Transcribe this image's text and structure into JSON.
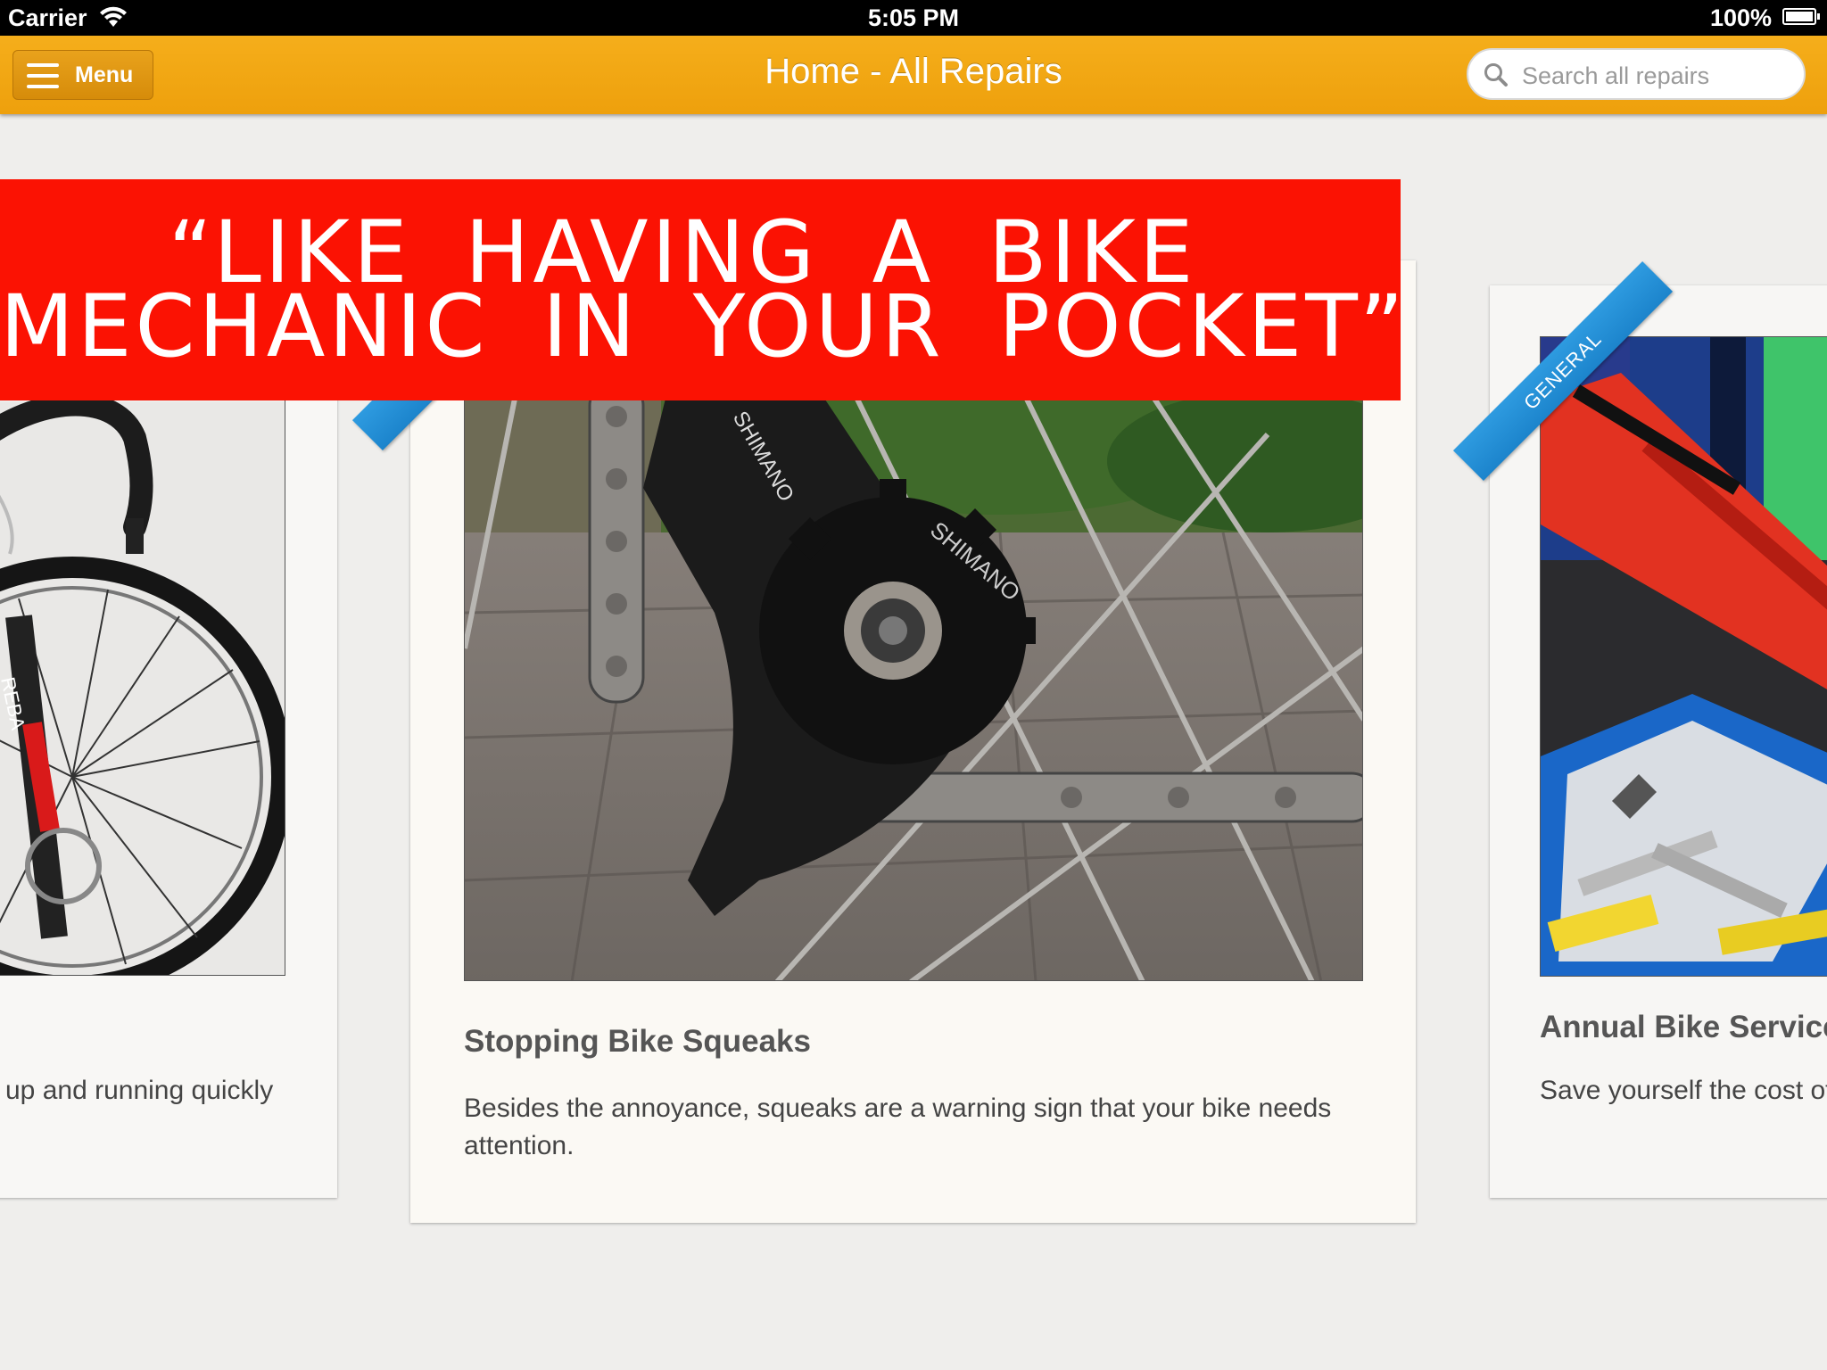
{
  "status_bar": {
    "carrier": "Carrier",
    "time": "5:05 PM",
    "battery": "100%"
  },
  "nav": {
    "menu_label": "Menu",
    "title": "Home - All Repairs",
    "search_placeholder": "Search all repairs"
  },
  "promo": {
    "line1": "“LIKE HAVING A BIKE",
    "line2": "MECHANIC IN YOUR POCKET”"
  },
  "cards": [
    {
      "title": "",
      "description": "up and running quickly"
    },
    {
      "title": "Stopping Bike Squeaks",
      "description": "Besides the annoyance, squeaks are a warning sign that your bike needs attention."
    },
    {
      "title": "Annual Bike Service",
      "description": "Save yourself the cost of",
      "ribbon": "GENERAL"
    }
  ],
  "colors": {
    "nav_orange": "#f1a410",
    "promo_red": "#fb1203",
    "ribbon_blue": "#2391d9"
  }
}
